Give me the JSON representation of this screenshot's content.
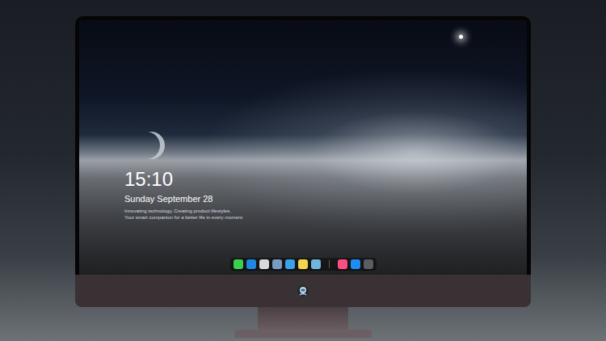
{
  "lockscreen": {
    "time": "15:10",
    "date": "Sunday September 28",
    "taglines": [
      "Innovating technology, Creating product lifestyles.",
      "Your smart companion for a better life in every moment."
    ]
  },
  "dock": {
    "apps": [
      {
        "color": "#3ccf4e"
      },
      {
        "color": "#1e88e5"
      },
      {
        "color": "#d9d9d9"
      },
      {
        "color": "#7a9cc2"
      },
      {
        "color": "#3aa0e8"
      },
      {
        "color": "#f2d54a"
      },
      {
        "color": "#6fb6dd"
      },
      {
        "color": "#fa4f82"
      },
      {
        "color": "#1f8bf5"
      },
      {
        "color": "#5a5d62"
      }
    ]
  }
}
